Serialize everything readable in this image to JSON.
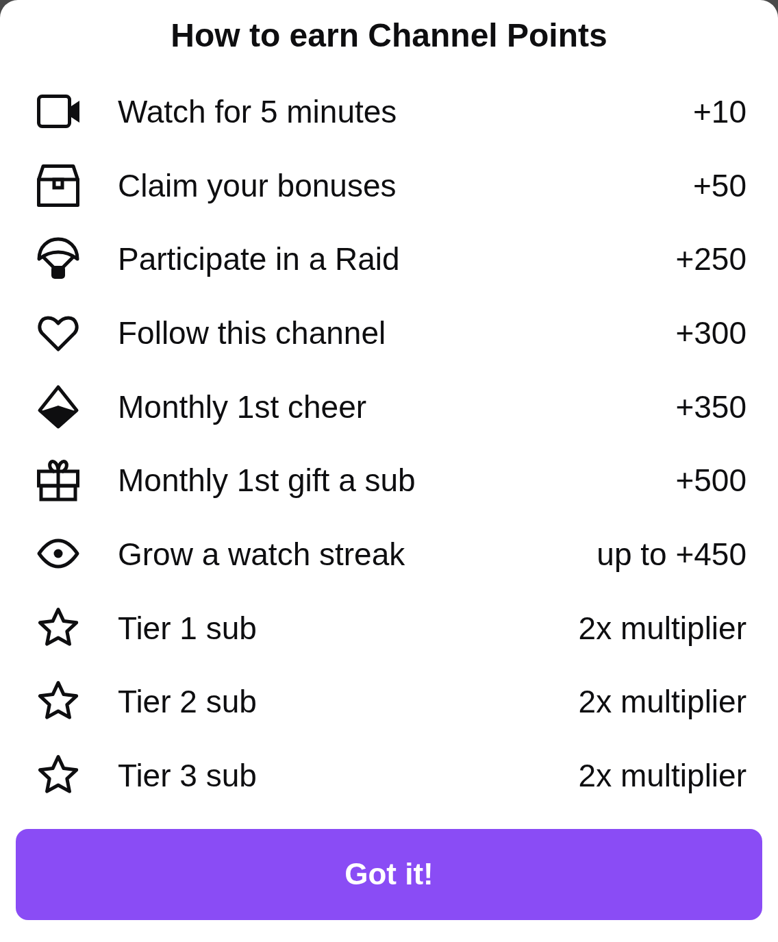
{
  "title": "How to earn Channel Points",
  "items": [
    {
      "kind": "watch",
      "label": "Watch for 5 minutes",
      "value": "+10"
    },
    {
      "kind": "bonus",
      "label": "Claim your bonuses",
      "value": "+50"
    },
    {
      "kind": "raid",
      "label": "Participate in a Raid",
      "value": "+250"
    },
    {
      "kind": "follow",
      "label": "Follow this channel",
      "value": "+300"
    },
    {
      "kind": "cheer",
      "label": "Monthly 1st cheer",
      "value": "+350"
    },
    {
      "kind": "gift",
      "label": "Monthly 1st gift a sub",
      "value": "+500"
    },
    {
      "kind": "streak",
      "label": "Grow a watch streak",
      "value": "up to +450"
    },
    {
      "kind": "sub",
      "label": "Tier 1 sub",
      "value": "2x multiplier"
    },
    {
      "kind": "sub",
      "label": "Tier 2 sub",
      "value": "2x multiplier"
    },
    {
      "kind": "sub",
      "label": "Tier 3 sub",
      "value": "2x multiplier"
    }
  ],
  "button": {
    "label": "Got it!"
  }
}
